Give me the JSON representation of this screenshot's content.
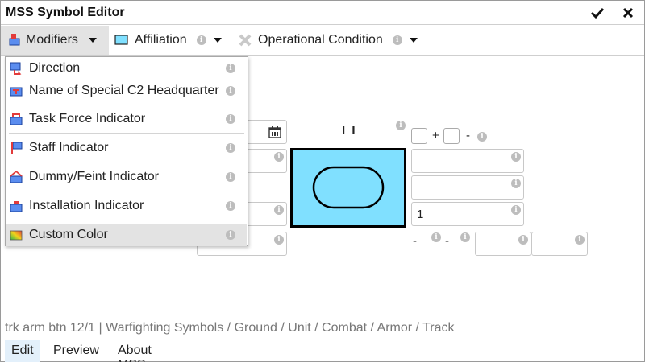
{
  "window": {
    "title": "MSS Symbol Editor",
    "actions": [
      {
        "name": "confirm",
        "icon": "checkmark-icon"
      },
      {
        "name": "close",
        "icon": "close-icon"
      }
    ]
  },
  "toolbar": {
    "modifiers_label": "Modifiers",
    "affiliation_label": "Affiliation",
    "operational_condition_label": "Operational Condition",
    "info_glyph": "i"
  },
  "modifiers_menu": {
    "items": [
      {
        "label": "Direction",
        "icon": "direction-flag-icon"
      },
      {
        "label": "Name of Special C2 Headquarter",
        "icon": "special-c2-headquarter-icon"
      },
      {
        "label": "Task Force Indicator",
        "icon": "task-force-indicator-icon"
      },
      {
        "label": "Staff Indicator",
        "icon": "staff-indicator-icon"
      },
      {
        "label": "Dummy/Feint Indicator",
        "icon": "dummy-feint-indicator-icon"
      },
      {
        "label": "Installation Indicator",
        "icon": "installation-indicator-icon"
      },
      {
        "label": "Custom Color",
        "icon": "custom-color-icon"
      }
    ],
    "highlighted_item": "Custom Color"
  },
  "symbol_editor": {
    "echelon_text": "I I",
    "plus_sign": "+",
    "minus_sign": "-",
    "field_value_1": "1",
    "bottom_minus_1": "-",
    "bottom_minus_2": "-",
    "symbol_fill_color": "#80e0ff",
    "calendar_icon": "calendar-icon"
  },
  "status": {
    "text": "trk arm btn 12/1 | Warfighting Symbols / Ground / Unit / Combat / Armor / Track"
  },
  "tabs": [
    {
      "label": "Edit",
      "active": true
    },
    {
      "label": "Preview",
      "active": false
    },
    {
      "label": "About MSS",
      "active": false
    }
  ]
}
